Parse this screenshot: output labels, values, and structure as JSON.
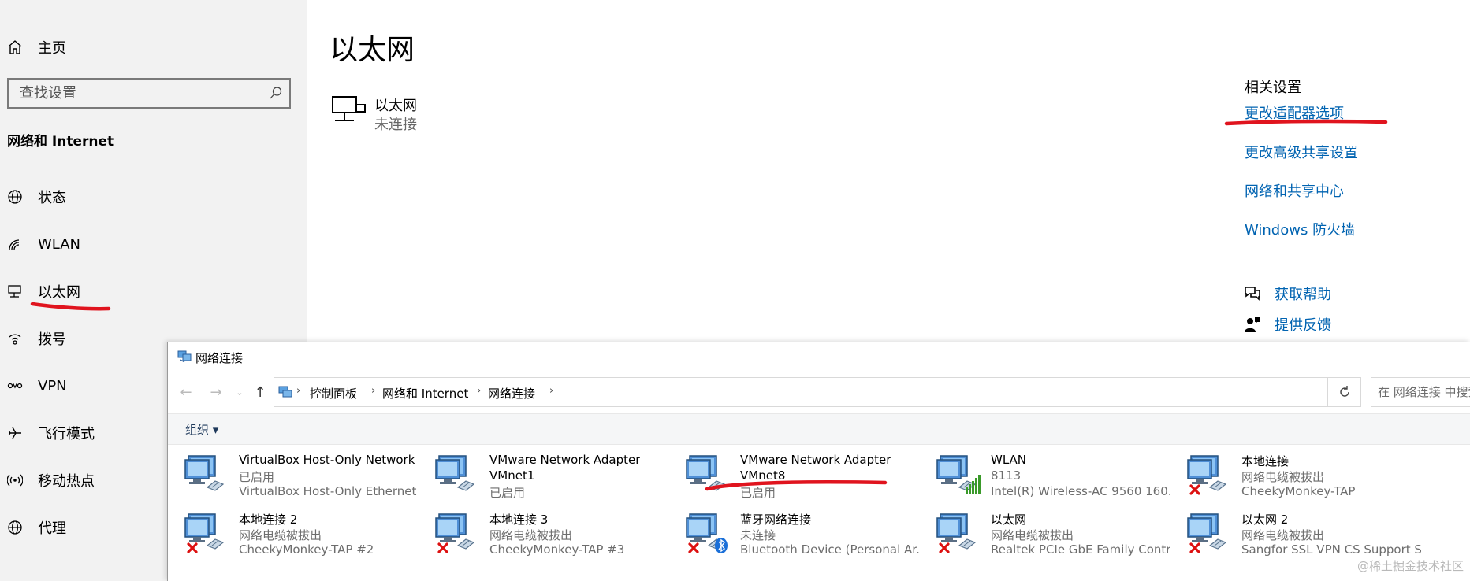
{
  "sidebar": {
    "home_label": "主页",
    "search_placeholder": "查找设置",
    "section_title": "网络和 Internet",
    "items": [
      {
        "label": "状态",
        "icon": "globe-status-icon"
      },
      {
        "label": "WLAN",
        "icon": "wifi-icon"
      },
      {
        "label": "以太网",
        "icon": "ethernet-icon"
      },
      {
        "label": "拨号",
        "icon": "dialup-icon"
      },
      {
        "label": "VPN",
        "icon": "vpn-icon"
      },
      {
        "label": "飞行模式",
        "icon": "airplane-icon"
      },
      {
        "label": "移动热点",
        "icon": "hotspot-icon"
      },
      {
        "label": "代理",
        "icon": "proxy-globe-icon"
      }
    ]
  },
  "main": {
    "title": "以太网",
    "ethernet_name": "以太网",
    "ethernet_status": "未连接",
    "related_title": "相关设置",
    "related_links": [
      "更改适配器选项",
      "更改高级共享设置",
      "网络和共享中心",
      "Windows 防火墙"
    ],
    "help_label": "获取帮助",
    "feedback_label": "提供反馈"
  },
  "netwin": {
    "title": "网络连接",
    "breadcrumbs": [
      "控制面板",
      "网络和 Internet",
      "网络连接"
    ],
    "search_placeholder": "在 网络连接 中搜索",
    "organize_label": "组织 ▾",
    "connections": [
      {
        "name": "VirtualBox Host-Only Network",
        "line2": "已启用",
        "line3": "VirtualBox Host-Only Ethernet ...",
        "state": "enabled"
      },
      {
        "name": "VMware Network Adapter",
        "line2": "VMnet1",
        "line3": "已启用",
        "state": "enabled"
      },
      {
        "name": "VMware Network Adapter",
        "line2": "VMnet8",
        "line3": "已启用",
        "state": "enabled"
      },
      {
        "name": "WLAN",
        "line2": "8113",
        "line3": "Intel(R) Wireless-AC 9560 160...",
        "state": "wifi"
      },
      {
        "name": "本地连接",
        "line2": "网络电缆被拔出",
        "line3": "CheekyMonkey-TAP",
        "state": "disconnected"
      },
      {
        "name": "本地连接 2",
        "line2": "网络电缆被拔出",
        "line3": "CheekyMonkey-TAP #2",
        "state": "disconnected"
      },
      {
        "name": "本地连接 3",
        "line2": "网络电缆被拔出",
        "line3": "CheekyMonkey-TAP #3",
        "state": "disconnected"
      },
      {
        "name": "蓝牙网络连接",
        "line2": "未连接",
        "line3": "Bluetooth Device (Personal Ar...",
        "state": "bluetooth"
      },
      {
        "name": "以太网",
        "line2": "网络电缆被拔出",
        "line3": "Realtek PCIe GbE Family Contr...",
        "state": "disconnected"
      },
      {
        "name": "以太网 2",
        "line2": "网络电缆被拔出",
        "line3": "Sangfor SSL VPN CS Support S...",
        "state": "disconnected"
      }
    ]
  },
  "watermark": "@稀土掘金技术社区",
  "colors": {
    "link": "#0063b1",
    "sidebar_bg": "#f2f2f2",
    "annotation_red": "#e0141e"
  }
}
